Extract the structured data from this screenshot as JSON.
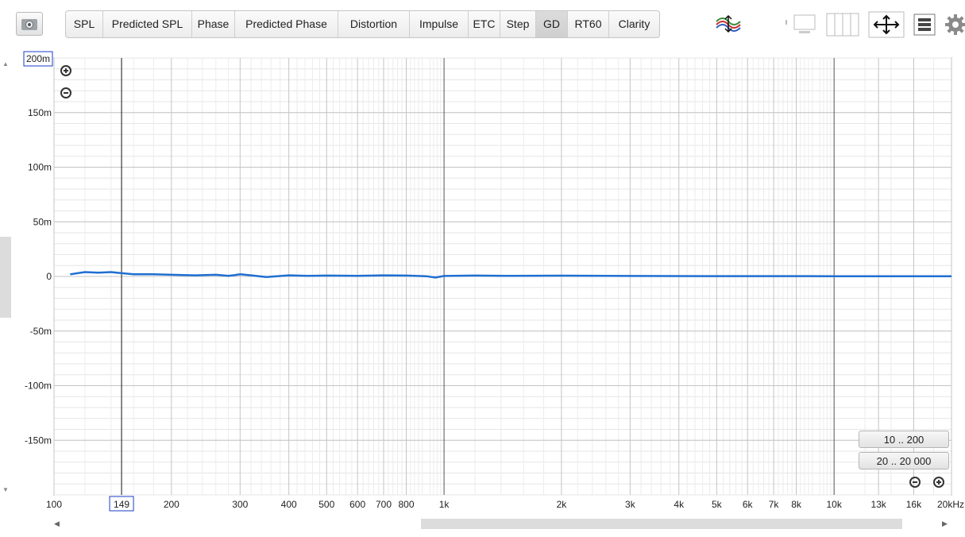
{
  "toolbar": {
    "camera_icon": "camera-icon",
    "tabs": [
      {
        "label": "SPL",
        "active": false
      },
      {
        "label": "Predicted SPL",
        "active": false
      },
      {
        "label": "Phase",
        "active": false
      },
      {
        "label": "Predicted Phase",
        "active": false
      },
      {
        "label": "Distortion",
        "active": false
      },
      {
        "label": "Impulse",
        "active": false
      },
      {
        "label": "ETC",
        "active": false
      },
      {
        "label": "Step",
        "active": false
      },
      {
        "label": "GD",
        "active": true
      },
      {
        "label": "RT60",
        "active": false
      },
      {
        "label": "Clarity",
        "active": false
      }
    ],
    "icons": [
      "overlay-traces-icon",
      "single-graph-icon",
      "graph-columns-icon",
      "pan-arrows-icon",
      "controls-list-icon",
      "gear-icon"
    ]
  },
  "graph": {
    "y_top_label": "200m",
    "y_ticks": [
      {
        "value": 0.15,
        "label": "150m"
      },
      {
        "value": 0.1,
        "label": "100m"
      },
      {
        "value": 0.05,
        "label": "50m"
      },
      {
        "value": 0,
        "label": "0"
      },
      {
        "value": -0.05,
        "label": "-50m"
      },
      {
        "value": -0.1,
        "label": "-100m"
      },
      {
        "value": -0.15,
        "label": "-150m"
      }
    ],
    "x_ticks": [
      {
        "value": 100,
        "label": "100"
      },
      {
        "value": 200,
        "label": "200"
      },
      {
        "value": 300,
        "label": "300"
      },
      {
        "value": 400,
        "label": "400"
      },
      {
        "value": 500,
        "label": "500"
      },
      {
        "value": 600,
        "label": "600"
      },
      {
        "value": 700,
        "label": "700"
      },
      {
        "value": 800,
        "label": "800"
      },
      {
        "value": 1000,
        "label": "1k"
      },
      {
        "value": 2000,
        "label": "2k"
      },
      {
        "value": 3000,
        "label": "3k"
      },
      {
        "value": 4000,
        "label": "4k"
      },
      {
        "value": 5000,
        "label": "5k"
      },
      {
        "value": 6000,
        "label": "6k"
      },
      {
        "value": 7000,
        "label": "7k"
      },
      {
        "value": 8000,
        "label": "8k"
      },
      {
        "value": 10000,
        "label": "10k"
      },
      {
        "value": 13000,
        "label": "13k"
      },
      {
        "value": 16000,
        "label": "16k"
      },
      {
        "value": 20000,
        "label": "20kHz"
      }
    ],
    "cursor_x_label": "149",
    "cursor_freq": 149,
    "range_buttons": [
      "10 .. 200",
      "20 .. 20 000"
    ]
  },
  "chart_data": {
    "type": "line",
    "xlim": [
      100,
      20000
    ],
    "ylim": [
      -0.2,
      0.2
    ],
    "x_scale": "log",
    "grid": true,
    "line_color": "#1f6fd1",
    "x": [
      110,
      120,
      130,
      140,
      149,
      160,
      180,
      200,
      230,
      260,
      280,
      290,
      300,
      320,
      350,
      400,
      450,
      500,
      600,
      700,
      800,
      900,
      950,
      1000,
      1200,
      1500,
      2000,
      3000,
      5000,
      10000,
      20000
    ],
    "y": [
      0.002,
      0.004,
      0.0035,
      0.004,
      0.003,
      0.002,
      0.002,
      0.0015,
      0.001,
      0.0015,
      0.0005,
      0.0012,
      0.002,
      0.001,
      -0.0005,
      0.001,
      0.0005,
      0.0008,
      0.0005,
      0.001,
      0.0008,
      0.0002,
      -0.001,
      0.0004,
      0.0008,
      0.0005,
      0.0007,
      0.0004,
      0.0003,
      0.0002,
      0.0002
    ]
  }
}
